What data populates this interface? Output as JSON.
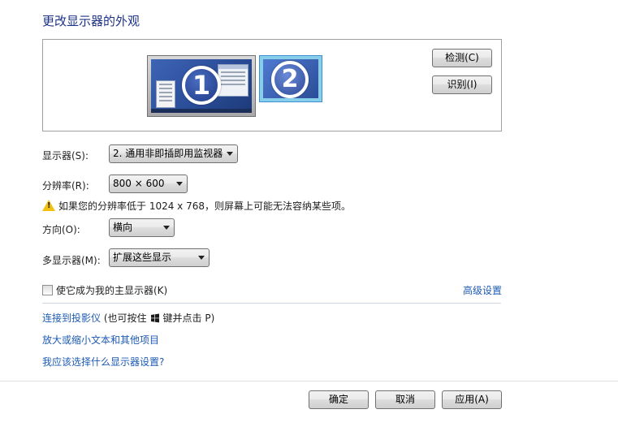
{
  "window": {
    "title": "更改显示器的外观"
  },
  "preview": {
    "monitor1_number": "1",
    "monitor2_number": "2",
    "detect_label": "检测(C)",
    "identify_label": "识别(I)"
  },
  "display": {
    "label": "显示器(S):",
    "value": "2. 通用非即插即用监视器"
  },
  "resolution": {
    "label": "分辨率(R):",
    "value": "800 × 600"
  },
  "warning": {
    "icon": "warning-icon",
    "text": "如果您的分辨率低于 1024 x 768，则屏幕上可能无法容纳某些项。"
  },
  "orientation": {
    "label": "方向(O):",
    "value": "横向"
  },
  "multi": {
    "label": "多显示器(M):",
    "value": "扩展这些显示"
  },
  "primary": {
    "label": "使它成为我的主显示器(K)",
    "checked": false
  },
  "advanced": {
    "label": "高级设置"
  },
  "links": {
    "projector_link": "连接到投影仪",
    "projector_hint_pre": "(也可按住",
    "projector_hint_post": "键并点击 P)",
    "text_size": "放大或缩小文本和其他项目",
    "which_settings": "我应该选择什么显示器设置?"
  },
  "footer": {
    "ok": "确定",
    "cancel": "取消",
    "apply": "应用(A)"
  },
  "colors": {
    "title": "#1e3287",
    "link": "#1e5bb5",
    "selected_monitor_border": "#87ceeb"
  }
}
